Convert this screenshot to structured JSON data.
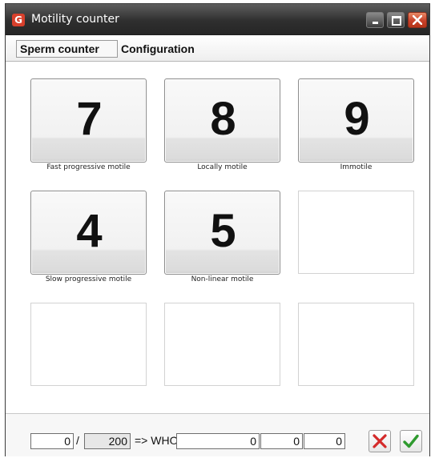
{
  "window": {
    "title": "Motility counter",
    "icon_name": "app-logo-icon",
    "icon_glyph": "G",
    "controls": [
      "minimize-icon",
      "maximize-icon",
      "close-icon"
    ]
  },
  "tabs": [
    {
      "label": "Sperm counter",
      "active": true
    },
    {
      "label": "Configuration",
      "active": false
    }
  ],
  "counter_buttons": [
    {
      "key": "7",
      "label": "Fast progressive motile"
    },
    {
      "key": "8",
      "label": "Locally motile"
    },
    {
      "key": "9",
      "label": "Immotile"
    },
    {
      "key": "4",
      "label": "Slow progressive motile"
    },
    {
      "key": "5",
      "label": "Non-linear motile"
    }
  ],
  "footer": {
    "count_value": "0",
    "separator": "/",
    "total_value": "200",
    "arrow_text": "=> WHO",
    "who_value_1": "0",
    "who_value_2": "0",
    "who_value_3": "0",
    "cancel_icon": "red-x-icon",
    "confirm_icon": "green-check-icon"
  },
  "colors": {
    "titlebar": "#2f2f2f",
    "close_button": "#c8412a",
    "cancel_red": "#d42a2a",
    "confirm_green": "#2e9a2e"
  }
}
